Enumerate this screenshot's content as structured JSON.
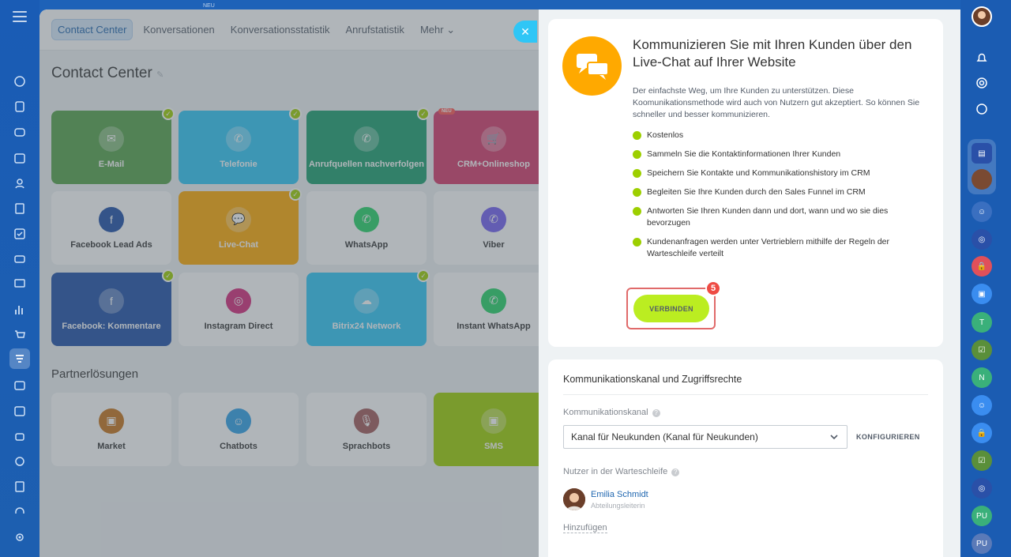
{
  "background_page": {
    "nav_tabs": [
      "Contact Center",
      "Konversationen",
      "Konversationsstatistik",
      "Anrufstatistik",
      "Mehr"
    ],
    "new_tag": "NEU",
    "title": "Contact Center",
    "tiles": [
      {
        "label": "E-Mail",
        "icon": "mail-icon",
        "color": "#55a24a",
        "connected": true
      },
      {
        "label": "Telefonie",
        "icon": "phone-icon",
        "color": "#2fc6f6",
        "connected": true
      },
      {
        "label": "Anrufquellen nachverfolgen",
        "icon": "call-tracking-icon",
        "color": "#1a9f6d",
        "connected": true
      },
      {
        "label": "CRM+Onlineshop",
        "icon": "cart-icon",
        "color": "#d63a6a",
        "connected": false,
        "badge": "NEU"
      },
      {
        "label": "Facebook Lead Ads",
        "icon": "facebook-lead-icon",
        "color": "#ffffff",
        "connected": false
      },
      {
        "label": "Live-Chat",
        "icon": "chat-icon",
        "color": "#ffa900",
        "connected": true
      },
      {
        "label": "WhatsApp",
        "icon": "whatsapp-icon",
        "color": "#ffffff",
        "connected": false
      },
      {
        "label": "Viber",
        "icon": "viber-icon",
        "color": "#ffffff",
        "connected": false
      },
      {
        "label": "Facebook: Kommentare",
        "icon": "facebook-comments-icon",
        "color": "#1e4fa8",
        "connected": true
      },
      {
        "label": "Instagram Direct",
        "icon": "instagram-icon",
        "color": "#ffffff",
        "connected": false
      },
      {
        "label": "Bitrix24 Network",
        "icon": "network-icon",
        "color": "#2fc6f6",
        "connected": true
      },
      {
        "label": "Instant WhatsApp",
        "icon": "whatsapp-icon",
        "color": "#ffffff",
        "connected": false
      }
    ],
    "partner_title": "Partnerlösungen",
    "partner_tiles": [
      {
        "label": "Market",
        "icon": "market-icon",
        "color": "#ffffff"
      },
      {
        "label": "Chatbots",
        "icon": "bot-icon",
        "color": "#ffffff"
      },
      {
        "label": "Sprachbots",
        "icon": "microphone-icon",
        "color": "#ffffff"
      },
      {
        "label": "SMS",
        "icon": "sms-icon",
        "color": "#9dcf00"
      }
    ]
  },
  "panel": {
    "headline": "Kommunizieren Sie mit Ihren Kunden über den Live-Chat auf Ihrer Website",
    "description": "Der einfachste Weg, um Ihre Kunden zu unterstützen. Diese Koomunikationsmethode wird auch von Nutzern gut akzeptiert. So können Sie schneller und besser kommunizieren.",
    "features": [
      "Kostenlos",
      "Sammeln Sie die Kontaktinformationen Ihrer Kunden",
      "Speichern Sie Kontakte und Kommunikationshistory im CRM",
      "Begleiten Sie Ihre Kunden durch den Sales Funnel im CRM",
      "Antworten Sie Ihren Kunden dann und dort, wann und wo sie dies bevorzugen",
      "Kundenanfragen werden unter Vertrieblern mithilfe der Regeln der Warteschleife verteilt"
    ],
    "connect_label": "VERBINDEN",
    "step_badge": "5",
    "settings": {
      "title": "Kommunikationskanal und Zugriffsrechte",
      "channel_label": "Kommunikationskanal",
      "channel_value": "Kanal für Neukunden (Kanal für Neukunden)",
      "configure_label": "KONFIGURIEREN",
      "queue_label": "Nutzer in der Warteschleife",
      "user_name": "Emilia Schmidt",
      "user_role": "Abteilungsleiterin",
      "add_label": "Hinzufügen"
    }
  },
  "right_bar": [
    "T",
    "N",
    "PU",
    "PU"
  ],
  "colors": {
    "accent": "#2fc6f6",
    "connect": "#bbed21",
    "success": "#9dcf00",
    "chat_orange": "#ffa900"
  }
}
